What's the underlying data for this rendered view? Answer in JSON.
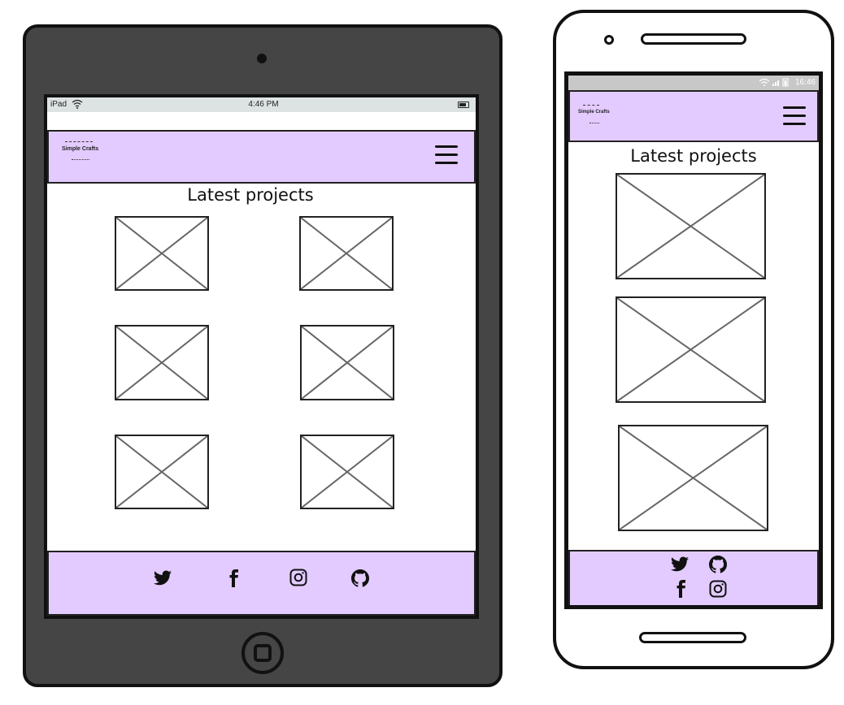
{
  "ipad": {
    "status_bar": {
      "carrier": "iPad",
      "time": "4:46 PM",
      "wifi_icon": "wifi-icon",
      "battery_icon": "battery-icon"
    },
    "header": {
      "logo_text": "Simple Crafts",
      "menu_icon": "hamburger-menu-icon",
      "background": "#e3cbff"
    },
    "main": {
      "title": "Latest projects",
      "image_placeholders": 6
    },
    "footer": {
      "icons": [
        "twitter-icon",
        "facebook-icon",
        "instagram-icon",
        "github-icon"
      ],
      "background": "#e3cbff"
    },
    "frame_color": "#454545"
  },
  "phone": {
    "status_bar": {
      "time": "16:46",
      "icons": "wifi signal battery"
    },
    "header": {
      "logo_text": "Simple Crafts",
      "menu_icon": "hamburger-menu-icon",
      "background": "#e3cbff"
    },
    "main": {
      "title": "Latest projects",
      "image_placeholders": 3
    },
    "footer": {
      "icons": [
        "twitter-icon",
        "github-icon",
        "facebook-icon",
        "instagram-icon"
      ],
      "background": "#e3cbff"
    }
  }
}
